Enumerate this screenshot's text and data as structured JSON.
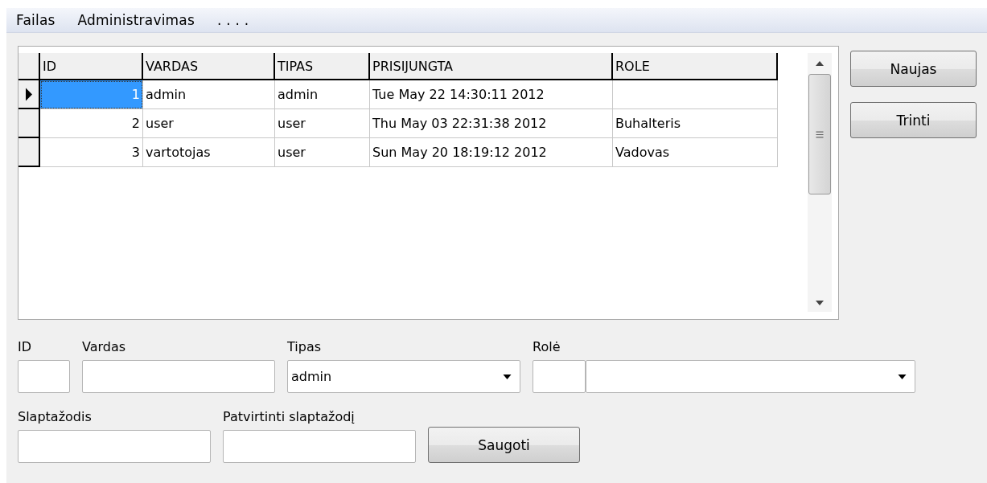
{
  "menu": [
    "Failas",
    "Administravimas",
    ". . . ."
  ],
  "table": {
    "columns": [
      "ID",
      "VARDAS",
      "TIPAS",
      "PRISIJUNGTA",
      "ROLE"
    ],
    "rows": [
      {
        "selected": true,
        "cells": [
          "1",
          "admin",
          "admin",
          "Tue May 22 14:30:11 2012",
          ""
        ]
      },
      {
        "selected": false,
        "cells": [
          "2",
          "user",
          "user",
          "Thu May 03 22:31:38 2012",
          "Buhalteris"
        ]
      },
      {
        "selected": false,
        "cells": [
          "3",
          "vartotojas",
          "user",
          "Sun May 20 18:19:12 2012",
          "Vadovas"
        ]
      }
    ]
  },
  "buttons": [
    "Naujas",
    "Trinti"
  ],
  "form": {
    "id_label": "ID",
    "name_label": "Vardas",
    "type_label": "Tipas",
    "type_value": "admin",
    "role_label": "Rolė",
    "password_label": "Slaptažodis",
    "confirm_label": "Patvirtinti slaptažodį",
    "save_button": "Saugoti"
  }
}
